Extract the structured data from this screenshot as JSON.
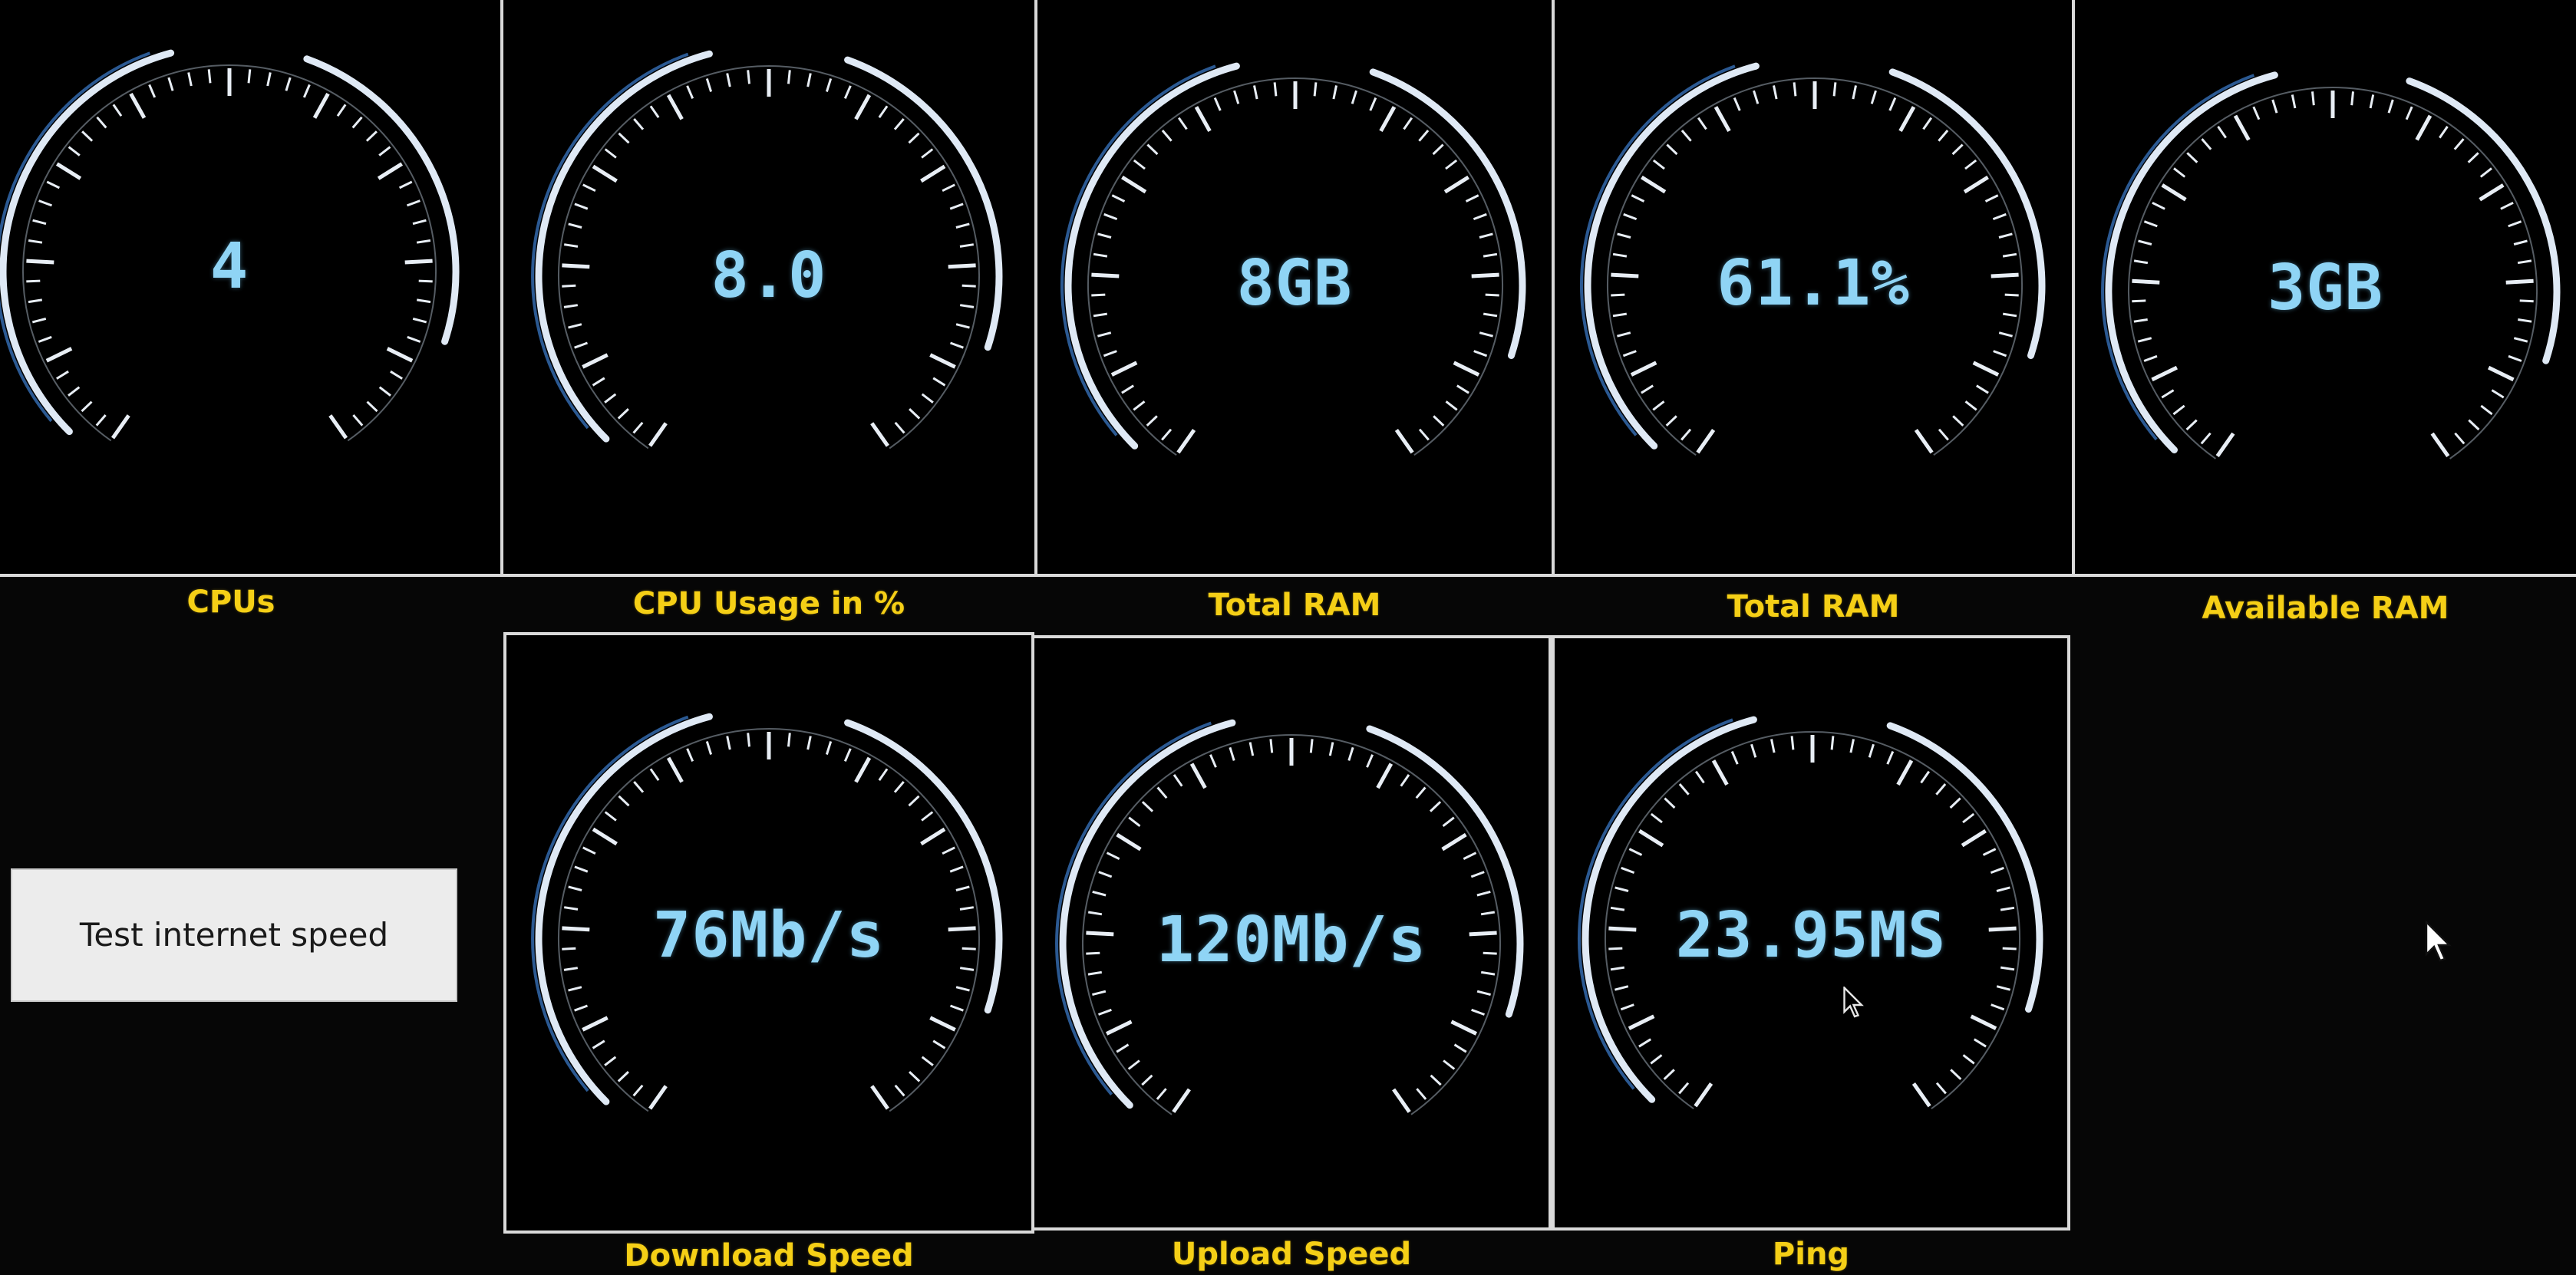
{
  "gauges_top": [
    {
      "id": "cpus",
      "value": "4",
      "label": "CPUs"
    },
    {
      "id": "cpu-usage",
      "value": "8.0",
      "label": "CPU Usage in %"
    },
    {
      "id": "total-ram",
      "value": "8GB",
      "label": "Total RAM"
    },
    {
      "id": "ram-percent",
      "value": "61.1%",
      "label": "Total RAM"
    },
    {
      "id": "available-ram",
      "value": "3GB",
      "label": "Available RAM"
    }
  ],
  "gauges_bottom": [
    {
      "id": "download",
      "value": "76Mb/s",
      "label": "Download Speed"
    },
    {
      "id": "upload",
      "value": "120Mb/s",
      "label": "Upload Speed"
    },
    {
      "id": "ping",
      "value": "23.95MS",
      "label": "Ping"
    }
  ],
  "controls": {
    "speed_test_button": "Test internet speed"
  },
  "colors": {
    "background": "#000000",
    "value_text": "#8fd4f5",
    "label_text": "#f5cf16",
    "divider": "#d9d9d9",
    "button_bg": "#ececec"
  },
  "icons": {
    "cursor": "arrow-cursor-icon"
  }
}
